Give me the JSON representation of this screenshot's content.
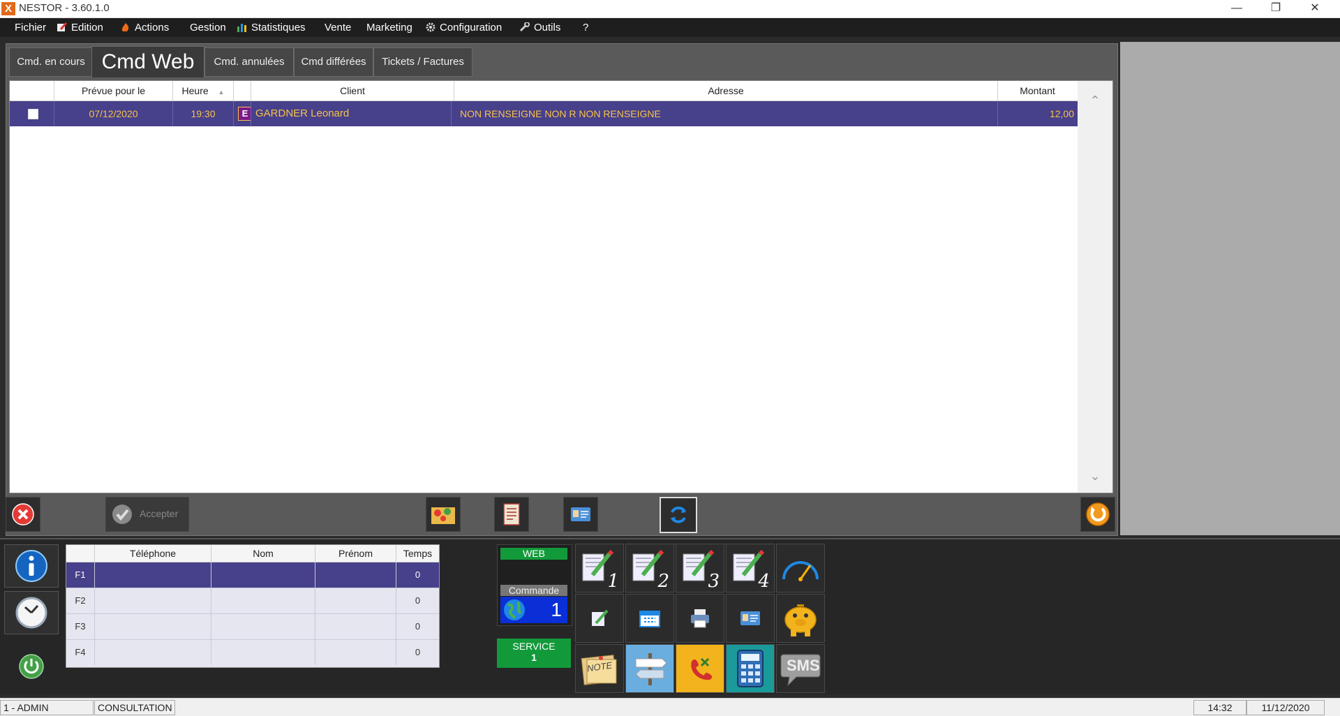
{
  "window": {
    "title": "NESTOR - 3.60.1.0",
    "logo": "X"
  },
  "menu": [
    {
      "label": "Fichier",
      "icon": ""
    },
    {
      "label": "Edition",
      "icon": "edit-icon"
    },
    {
      "label": "Actions",
      "icon": "fire-icon"
    },
    {
      "label": "Gestion",
      "icon": ""
    },
    {
      "label": "Statistiques",
      "icon": "chart-icon"
    },
    {
      "label": "Vente",
      "icon": ""
    },
    {
      "label": "Marketing",
      "icon": ""
    },
    {
      "label": "Configuration",
      "icon": "gear-icon"
    },
    {
      "label": "Outils",
      "icon": "wrench-icon"
    },
    {
      "label": "?",
      "icon": ""
    }
  ],
  "tabs": [
    "Cmd. en cours",
    "Cmd Web",
    "Cmd. annulées",
    "Cmd différées",
    "Tickets / Factures"
  ],
  "orders": {
    "columns": [
      "",
      "Prévue pour le",
      "Heure",
      "",
      "Client",
      "Adresse",
      "Montant"
    ],
    "rows": [
      {
        "date": "07/12/2020",
        "time": "19:30",
        "badge": "E",
        "client": "GARDNER Leonard",
        "address": "NON RENSEIGNE NON R NON RENSEIGNE",
        "amount": "12,00"
      }
    ]
  },
  "toolbar": {
    "accept_label": "Accepter"
  },
  "calls": {
    "columns": [
      "",
      "Téléphone",
      "Nom",
      "Prénom",
      "Temps"
    ],
    "rows": [
      {
        "key": "F1",
        "phone": "",
        "name": "",
        "firstname": "",
        "time": "0"
      },
      {
        "key": "F2",
        "phone": "",
        "name": "",
        "firstname": "",
        "time": "0"
      },
      {
        "key": "F3",
        "phone": "",
        "name": "",
        "firstname": "",
        "time": "0"
      },
      {
        "key": "F4",
        "phone": "",
        "name": "",
        "firstname": "",
        "time": "0"
      }
    ]
  },
  "web_panel": {
    "header": "WEB",
    "label": "Commande",
    "count": "1"
  },
  "service": {
    "label": "SERVICE",
    "value": "1"
  },
  "quick_buttons": {
    "order_numbers": [
      "1",
      "2",
      "3",
      "4"
    ],
    "note_label": "NOTE",
    "sms_label": "SMS"
  },
  "status": {
    "user": "1 - ADMIN",
    "mode": "CONSULTATION",
    "time": "14:32",
    "date": "11/12/2020"
  },
  "colors": {
    "selection": "#47408a",
    "row_text": "#f7c24a",
    "service": "#129a3a",
    "web_count_bg": "#0a2fd6"
  }
}
